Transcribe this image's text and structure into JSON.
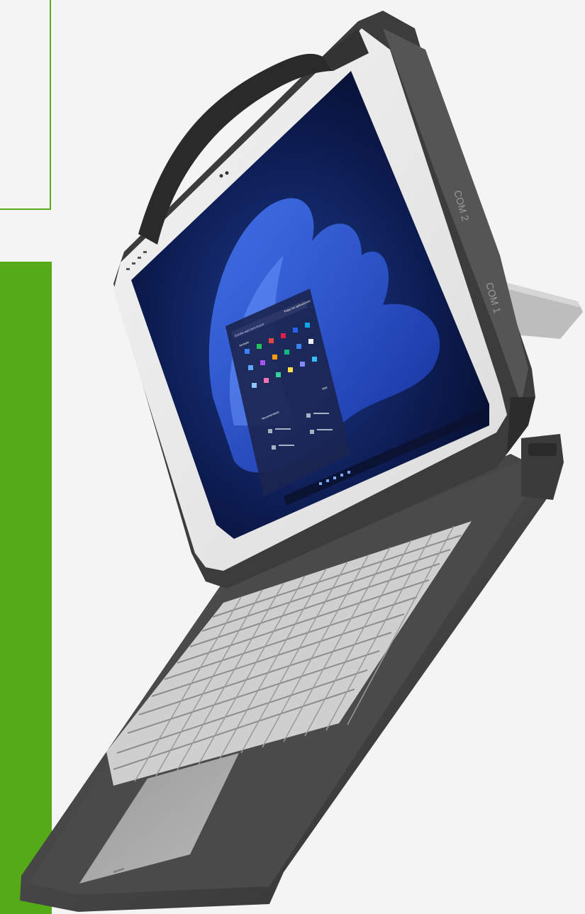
{
  "brand": {
    "accent": "#55ab17",
    "background": "#f4f4f4"
  },
  "product_photo": {
    "subject": "rugged-2-in-1-tablet-with-detachable-keyboard",
    "port_labels": [
      "COM 2",
      "COM 1"
    ]
  },
  "start_menu": {
    "search_placeholder": "Escribe aquí para buscar",
    "section_pinned": "Anclado",
    "all_apps": "Todas las aplicaciones",
    "section_recommended": "Recomendado",
    "more": "Más"
  }
}
